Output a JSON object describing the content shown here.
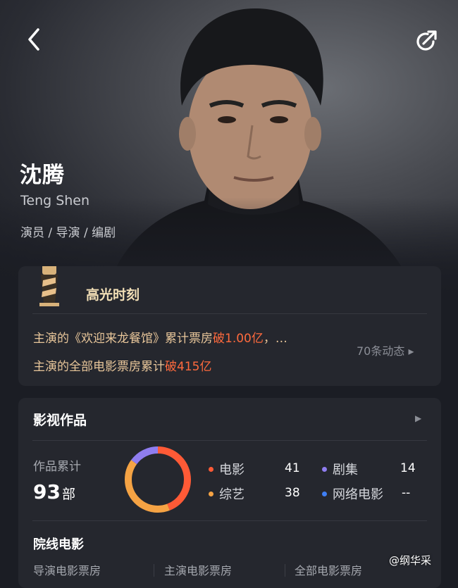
{
  "profile": {
    "name_cn": "沈腾",
    "name_en": "Teng Shen",
    "roles": "演员 / 导演 / 编剧"
  },
  "highlights": {
    "title": "高光时刻",
    "line1_prefix": "主演的《欢迎来龙餐馆》累计票房",
    "line1_highlight": "破1.00亿",
    "line1_suffix": "，…",
    "line2_prefix": "主演的全部电影票房累计",
    "line2_highlight": "破415亿",
    "more_label": "70条动态 ▸"
  },
  "works": {
    "title": "影视作品",
    "total_label": "作品累计",
    "total_value": "93",
    "total_unit": "部",
    "legend": [
      {
        "label": "电影",
        "value": "41",
        "color": "#ff5a36"
      },
      {
        "label": "综艺",
        "value": "38",
        "color": "#f5a344"
      },
      {
        "label": "剧集",
        "value": "14",
        "color": "#8f7df0"
      },
      {
        "label": "网络电影",
        "value": "--",
        "color": "#3f7ff5"
      }
    ],
    "cinema_title": "院线电影",
    "box_labels": [
      "导演电影票房",
      "主演电影票房",
      "全部电影票房"
    ]
  },
  "watermark": "@纲华采",
  "icons": {
    "back": "chevron-left-icon",
    "share": "share-icon",
    "highlight": "lighthouse-icon",
    "arrow": "triangle-right-icon"
  }
}
